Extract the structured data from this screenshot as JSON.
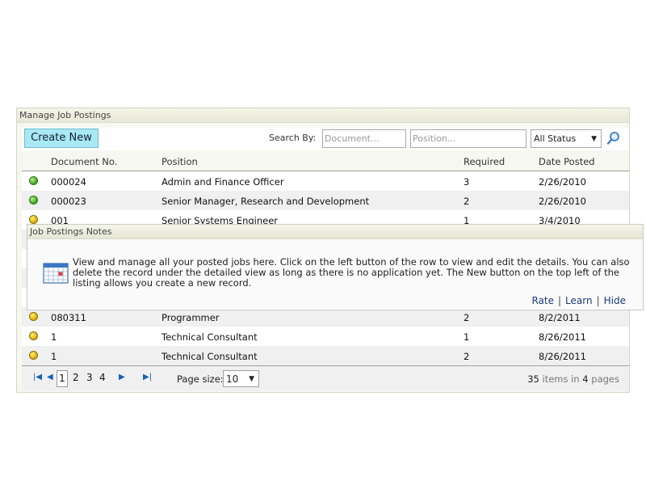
{
  "panel": {
    "title": "Manage Job Postings"
  },
  "toolbar": {
    "create_label": "Create New",
    "search_by_label": "Search By:",
    "document_placeholder": "Document...",
    "position_placeholder": "Position...",
    "status_value": "All Status"
  },
  "table": {
    "headers": {
      "document": "Document No.",
      "position": "Position",
      "required": "Required",
      "date": "Date Posted"
    },
    "rows": [
      {
        "status": "green",
        "document": "000024",
        "position": "Admin and Finance Officer",
        "required": "3",
        "date": "2/26/2010"
      },
      {
        "status": "green",
        "document": "000023",
        "position": "Senior Manager, Research and Development",
        "required": "2",
        "date": "2/26/2010"
      },
      {
        "status": "yellow",
        "document": "001",
        "position": "Senior Systems Engineer",
        "required": "1",
        "date": "3/4/2010"
      },
      {
        "status": "yellow",
        "document": "080311",
        "position": "Programmer",
        "required": "2",
        "date": "8/2/2011"
      },
      {
        "status": "yellow",
        "document": "1",
        "position": "Technical Consultant",
        "required": "1",
        "date": "8/26/2011"
      },
      {
        "status": "yellow",
        "document": "1",
        "position": "Technical Consultant",
        "required": "2",
        "date": "8/26/2011"
      }
    ]
  },
  "pager": {
    "pages": [
      "1",
      "2",
      "3",
      "4"
    ],
    "current_page": "1",
    "page_size_label": "Page size:",
    "page_size_value": "10",
    "items_count": "35",
    "items_word": " items in ",
    "pages_count": "4",
    "pages_word": " pages"
  },
  "notes": {
    "title": "Job Postings Notes",
    "text": "View and manage all your posted jobs here. Click on the left button of the row to view and edit the details. You can also delete the record under the detailed view as long as there is no application yet. The New button on the top left of the listing allows you create a new record.",
    "rate": "Rate",
    "learn": "Learn",
    "hide": "Hide"
  },
  "icons": {
    "search": "magnifier-icon",
    "notes": "calendar-icon",
    "first": "first-page-icon",
    "prev": "prev-page-icon",
    "next": "next-page-icon",
    "last": "last-page-icon"
  },
  "colors": {
    "create_button": "#a9e8f5",
    "status_green": "#3aa01c",
    "status_yellow": "#d8a800",
    "link": "#1a3d7a"
  }
}
